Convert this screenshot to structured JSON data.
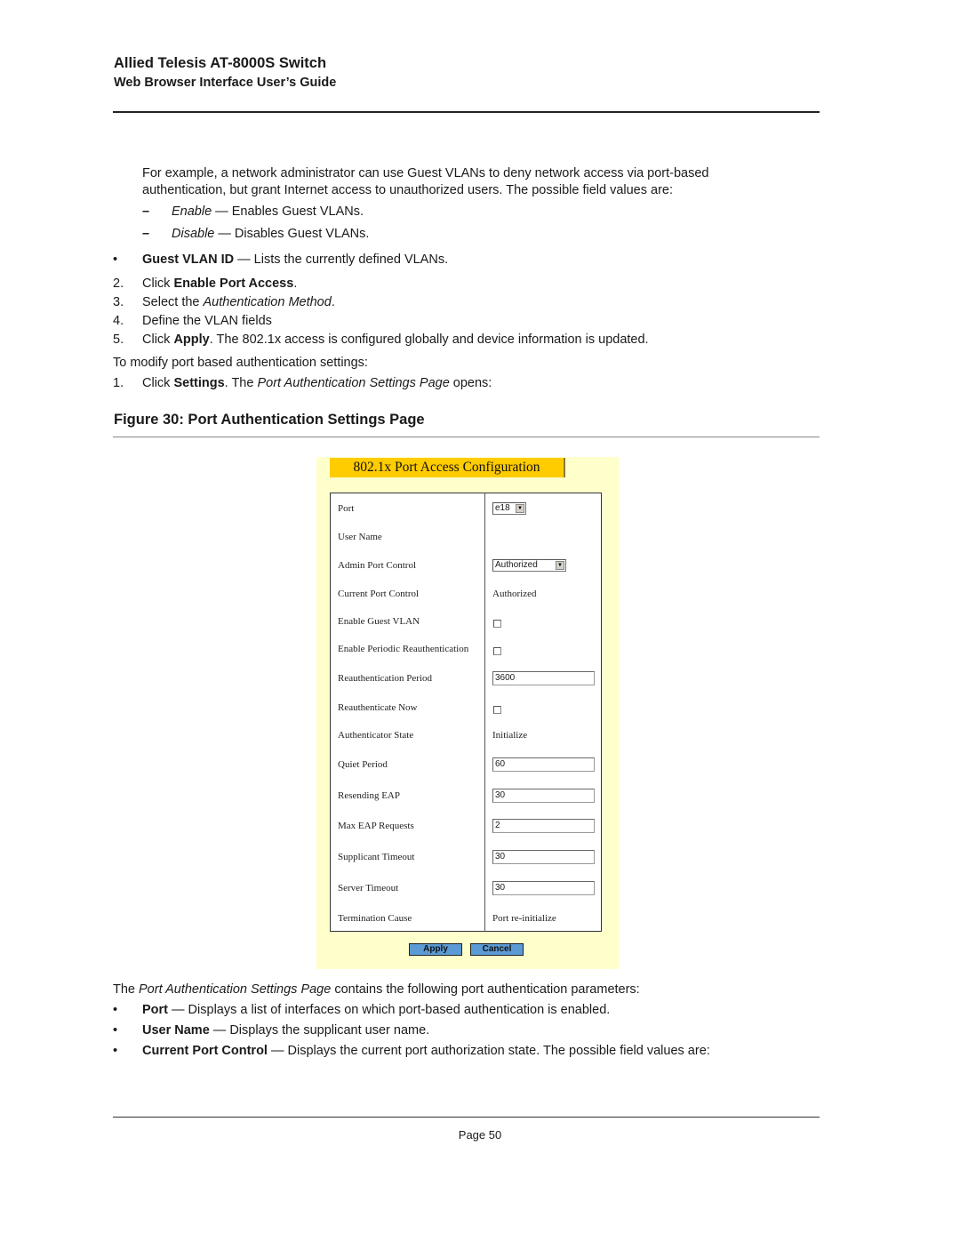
{
  "header": {
    "title": "Allied Telesis AT-8000S Switch",
    "subtitle": "Web Browser Interface User’s Guide"
  },
  "body": {
    "intro_line1": "For example, a network administrator can use Guest VLANs to deny network access via port-based",
    "intro_line2": "authentication, but grant Internet access to unauthorized users. The possible field values are:",
    "dash_items": [
      {
        "marker": "–",
        "term": "Enable",
        "desc": " — Enables Guest VLANs."
      },
      {
        "marker": "–",
        "term": "Disable",
        "desc": " — Disables Guest VLANs."
      }
    ],
    "bullet_guest_vlan": {
      "marker": "•",
      "term": "Guest VLAN ID",
      "desc": " — Lists the currently defined VLANs."
    },
    "steps": [
      {
        "num": "2.",
        "pre": "Click ",
        "bold": "Enable Port Access",
        "post": "."
      },
      {
        "num": "3.",
        "pre": "Select the ",
        "italic": "Authentication Method",
        "post": "."
      },
      {
        "num": "4.",
        "pre": "Define the VLAN fields"
      },
      {
        "num": "5.",
        "pre": "Click ",
        "bold": "Apply",
        "post": ". The 802.1x access is configured globally and device information is updated."
      }
    ],
    "modify_intro": "To modify port based authentication settings:",
    "step_settings": {
      "num": "1.",
      "pre": "Click ",
      "bold": "Settings",
      "mid": ". The ",
      "italic": "Port Authentication Settings Page",
      "post": " opens:"
    },
    "figure_title": "Figure 30:  Port Authentication Settings Page",
    "after_fig": {
      "pre": "The ",
      "italic": "Port Authentication Settings Page",
      "post": " contains the following port authentication parameters:"
    },
    "param_bullets": [
      {
        "marker": "•",
        "term": "Port",
        "desc": " — Displays a list of interfaces on which port-based authentication is enabled."
      },
      {
        "marker": "•",
        "term": "User Name",
        "desc": " — Displays the supplicant user name."
      },
      {
        "marker": "•",
        "term": "Current Port Control",
        "desc": " — Displays the current port authorization state. The possible field values are:"
      }
    ]
  },
  "figure": {
    "title": "802.1x Port Access Configuration",
    "colors": {
      "panel_bg": "#ffffcc",
      "title_bg": "#ffcc00",
      "button_bg": "#5b9bd5"
    },
    "fields": [
      {
        "label": "Port",
        "type": "select",
        "value": "e18"
      },
      {
        "label": "User Name",
        "type": "text",
        "value": ""
      },
      {
        "label": "Admin Port Control",
        "type": "select",
        "value": "Authorized"
      },
      {
        "label": "Current Port Control",
        "type": "text",
        "value": "Authorized"
      },
      {
        "label": "Enable Guest VLAN",
        "type": "checkbox",
        "checked": false
      },
      {
        "label": "Enable Periodic Reauthentication",
        "type": "checkbox",
        "checked": false
      },
      {
        "label": "Reauthentication Period",
        "type": "input",
        "value": "3600"
      },
      {
        "label": "Reauthenticate Now",
        "type": "checkbox",
        "checked": false
      },
      {
        "label": "Authenticator State",
        "type": "text",
        "value": "Initialize"
      },
      {
        "label": "Quiet Period",
        "type": "input",
        "value": "60"
      },
      {
        "label": "Resending EAP",
        "type": "input",
        "value": "30"
      },
      {
        "label": "Max EAP Requests",
        "type": "input",
        "value": "2"
      },
      {
        "label": "Supplicant Timeout",
        "type": "input",
        "value": "30"
      },
      {
        "label": "Server Timeout",
        "type": "input",
        "value": "30"
      },
      {
        "label": "Termination Cause",
        "type": "text",
        "value": "Port re-initialize"
      }
    ],
    "apply_label": "Apply",
    "cancel_label": "Cancel"
  },
  "footer": {
    "page": "Page 50"
  }
}
